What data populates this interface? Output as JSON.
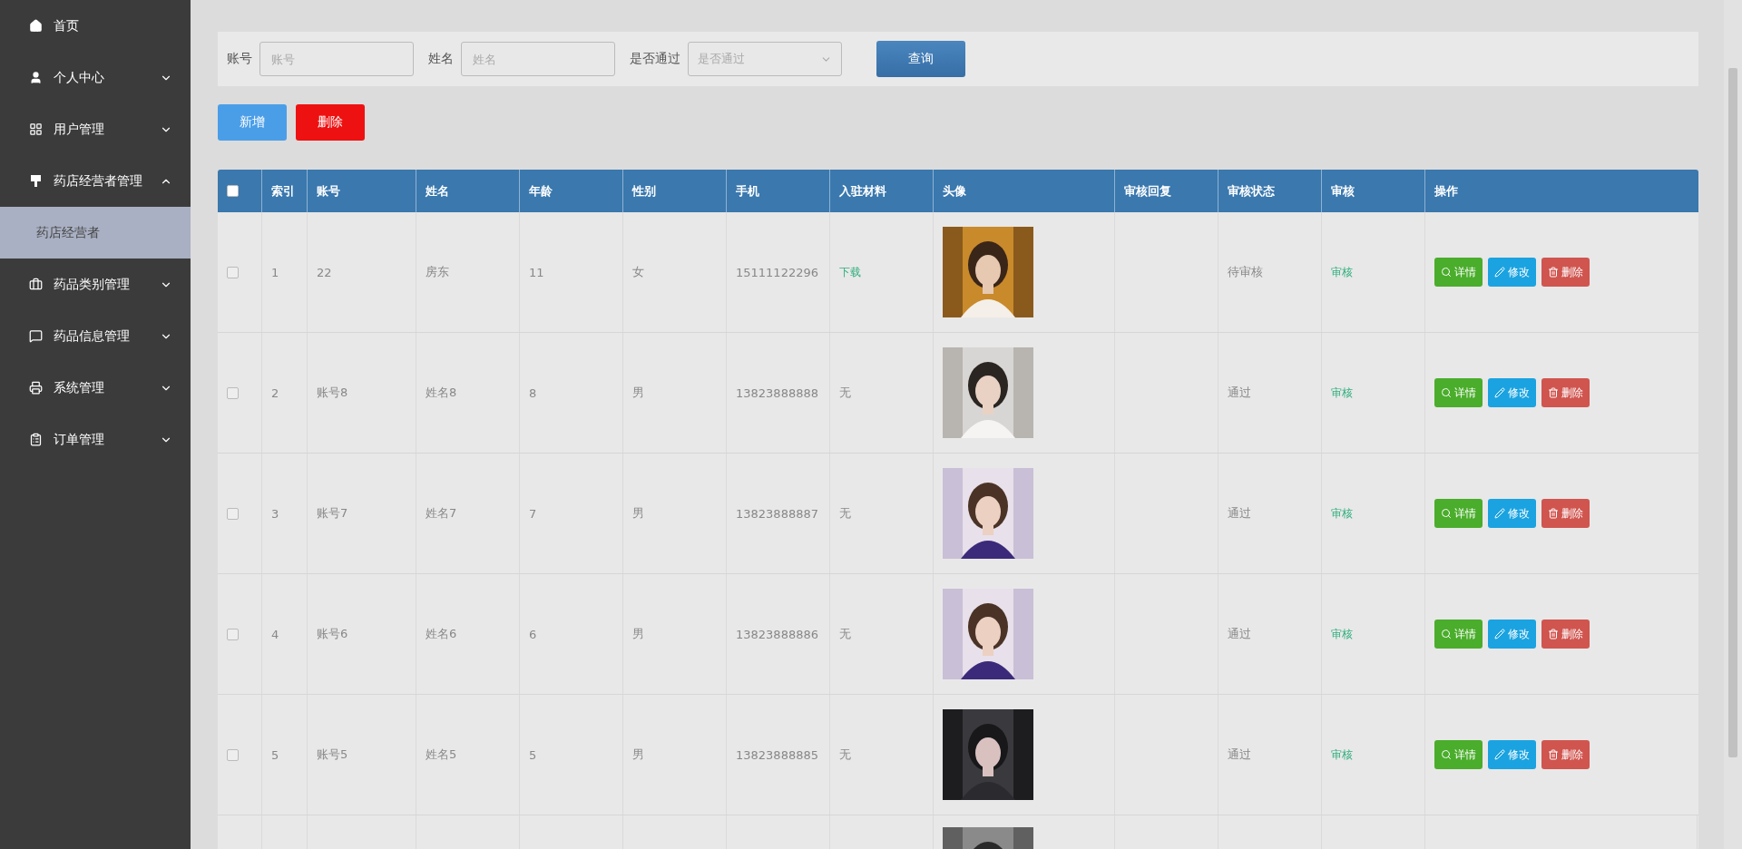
{
  "sidebar": {
    "items": [
      {
        "label": "首页"
      },
      {
        "label": "个人中心",
        "expanded": false
      },
      {
        "label": "用户管理",
        "expanded": false
      },
      {
        "label": "药店经营者管理",
        "expanded": true,
        "children": [
          {
            "label": "药店经营者",
            "selected": true
          }
        ]
      },
      {
        "label": "药品类别管理",
        "expanded": false
      },
      {
        "label": "药品信息管理",
        "expanded": false
      },
      {
        "label": "系统管理",
        "expanded": false
      },
      {
        "label": "订单管理",
        "expanded": false
      }
    ]
  },
  "search": {
    "fields": [
      {
        "kind": "input",
        "label": "账号",
        "placeholder": "账号"
      },
      {
        "kind": "input",
        "label": "姓名",
        "placeholder": "姓名"
      },
      {
        "kind": "select",
        "label": "是否通过",
        "placeholder": "是否通过"
      }
    ],
    "button": "查询"
  },
  "actions": [
    {
      "kind": "add",
      "label": "新增"
    },
    {
      "kind": "delete",
      "label": "删除"
    }
  ],
  "table": {
    "select_all": {
      "checked": false
    },
    "columns": [
      "索引",
      "账号",
      "姓名",
      "年龄",
      "性别",
      "手机",
      "入驻材料",
      "头像",
      "审核回复",
      "审核状态",
      "审核",
      "操作"
    ],
    "rows": [
      {
        "checked": false,
        "index": "1",
        "account": "22",
        "name": "房东",
        "age": "11",
        "gender": "女",
        "phone": "15111122296",
        "material": {
          "kind": "link",
          "text": "下载"
        },
        "status": "待审核",
        "review": "审核",
        "buttons": [
          "详情",
          "修改",
          "删除"
        ]
      },
      {
        "checked": false,
        "index": "2",
        "account": "账号8",
        "name": "姓名8",
        "age": "8",
        "gender": "男",
        "phone": "13823888888",
        "material": {
          "kind": "text",
          "text": "无"
        },
        "status": "通过",
        "review": "审核",
        "buttons": [
          "详情",
          "修改",
          "删除"
        ]
      },
      {
        "checked": false,
        "index": "3",
        "account": "账号7",
        "name": "姓名7",
        "age": "7",
        "gender": "男",
        "phone": "13823888887",
        "material": {
          "kind": "text",
          "text": "无"
        },
        "status": "通过",
        "review": "审核",
        "buttons": [
          "详情",
          "修改",
          "删除"
        ]
      },
      {
        "checked": false,
        "index": "4",
        "account": "账号6",
        "name": "姓名6",
        "age": "6",
        "gender": "男",
        "phone": "13823888886",
        "material": {
          "kind": "text",
          "text": "无"
        },
        "status": "通过",
        "review": "审核",
        "buttons": [
          "详情",
          "修改",
          "删除"
        ]
      },
      {
        "checked": false,
        "index": "5",
        "account": "账号5",
        "name": "姓名5",
        "age": "5",
        "gender": "男",
        "phone": "13823888885",
        "material": {
          "kind": "text",
          "text": "无"
        },
        "status": "通过",
        "review": "审核",
        "buttons": [
          "详情",
          "修改",
          "删除"
        ]
      }
    ]
  }
}
